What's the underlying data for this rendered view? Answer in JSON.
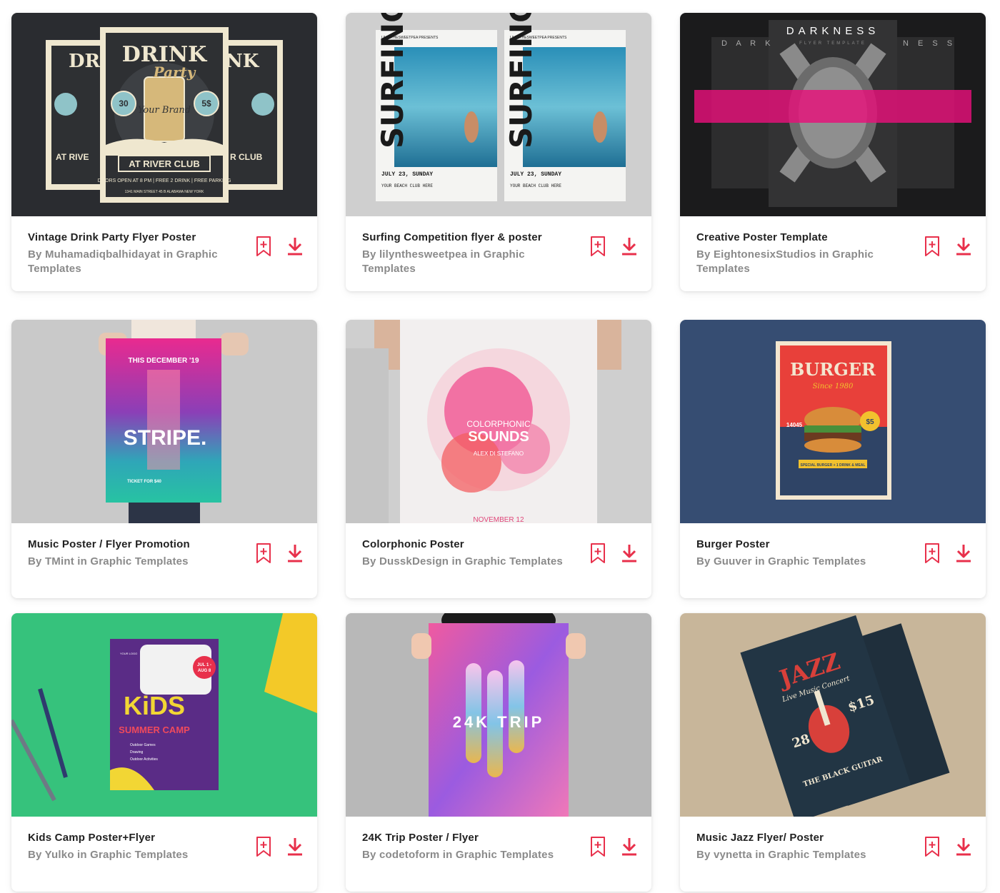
{
  "colors": {
    "accent": "#e8304b",
    "title": "#222222",
    "byline": "#8a8a8a"
  },
  "items": [
    {
      "title": "Vintage Drink Party Flyer Poster",
      "byline": "By Muhamadiqbalhidayat in Graphic Templates",
      "art": {
        "t1": "DRINK",
        "t2": "Party",
        "t3": "Your Brand",
        "t4": "AT RIVER CLUB",
        "t5": "DOORS OPEN AT 8 PM | FREE 2 DRINK | FREE PARKING",
        "t6": "30",
        "t7": "5$",
        "t8": "1341 MAIN STREET 45 B ALABAMA NEW YORK"
      }
    },
    {
      "title": "Surfing Competition flyer & poster",
      "byline": "By lilynthesweetpea in Graphic Templates",
      "art": {
        "t1": "SURFING",
        "t2": "JULY 23, SUNDAY",
        "t3": "YOUR BEACH CLUB HERE",
        "t4": "LILYNTHESWEETPEA PRESENTS"
      }
    },
    {
      "title": "Creative Poster Template",
      "byline": "By EightonesixStudios in Graphic Templates",
      "art": {
        "t1": "DARKNESS",
        "t2": "FLYER TEMPLATE"
      }
    },
    {
      "title": "Music Poster / Flyer Promotion",
      "byline": "By TMint in Graphic Templates",
      "art": {
        "t1": "THIS DECEMBER '19",
        "t2": "STRIPE.",
        "t3": "TICKET FOR $40"
      }
    },
    {
      "title": "Colorphonic Poster",
      "byline": "By DusskDesign in Graphic Templates",
      "art": {
        "t1": "COLORPHONIC",
        "t2": "SOUNDS",
        "t3": "ALEX DI STEFANO",
        "t4": "NOVEMBER 12"
      }
    },
    {
      "title": "Burger Poster",
      "byline": "By Guuver in Graphic Templates",
      "art": {
        "t1": "BURGER",
        "t2": "Since 1980",
        "t3": "$5",
        "t4": "SPECIAL BURGER + 1 DRINK & MEAL",
        "t5": "14045"
      }
    },
    {
      "title": "Kids Camp Poster+Flyer",
      "byline": "By Yulko in Graphic Templates",
      "art": {
        "t1": "KiDS",
        "t2": "SUMMER CAMP",
        "t3": "JUL 1 - AUG 8",
        "t4": "Outdoor Games",
        "t5": "Drawing",
        "t6": "Outdoor Activities",
        "t7": "YOUR LOGO"
      }
    },
    {
      "title": "24K Trip Poster / Flyer",
      "byline": "By codetoform in Graphic Templates",
      "art": {
        "t1": "24K TRIP"
      }
    },
    {
      "title": "Music Jazz Flyer/ Poster",
      "byline": "By vynetta in Graphic Templates",
      "art": {
        "t1": "JAZZ",
        "t2": "Live Music Concert",
        "t3": "28",
        "t4": "$15",
        "t5": "THE BLACK GUITAR"
      }
    }
  ]
}
